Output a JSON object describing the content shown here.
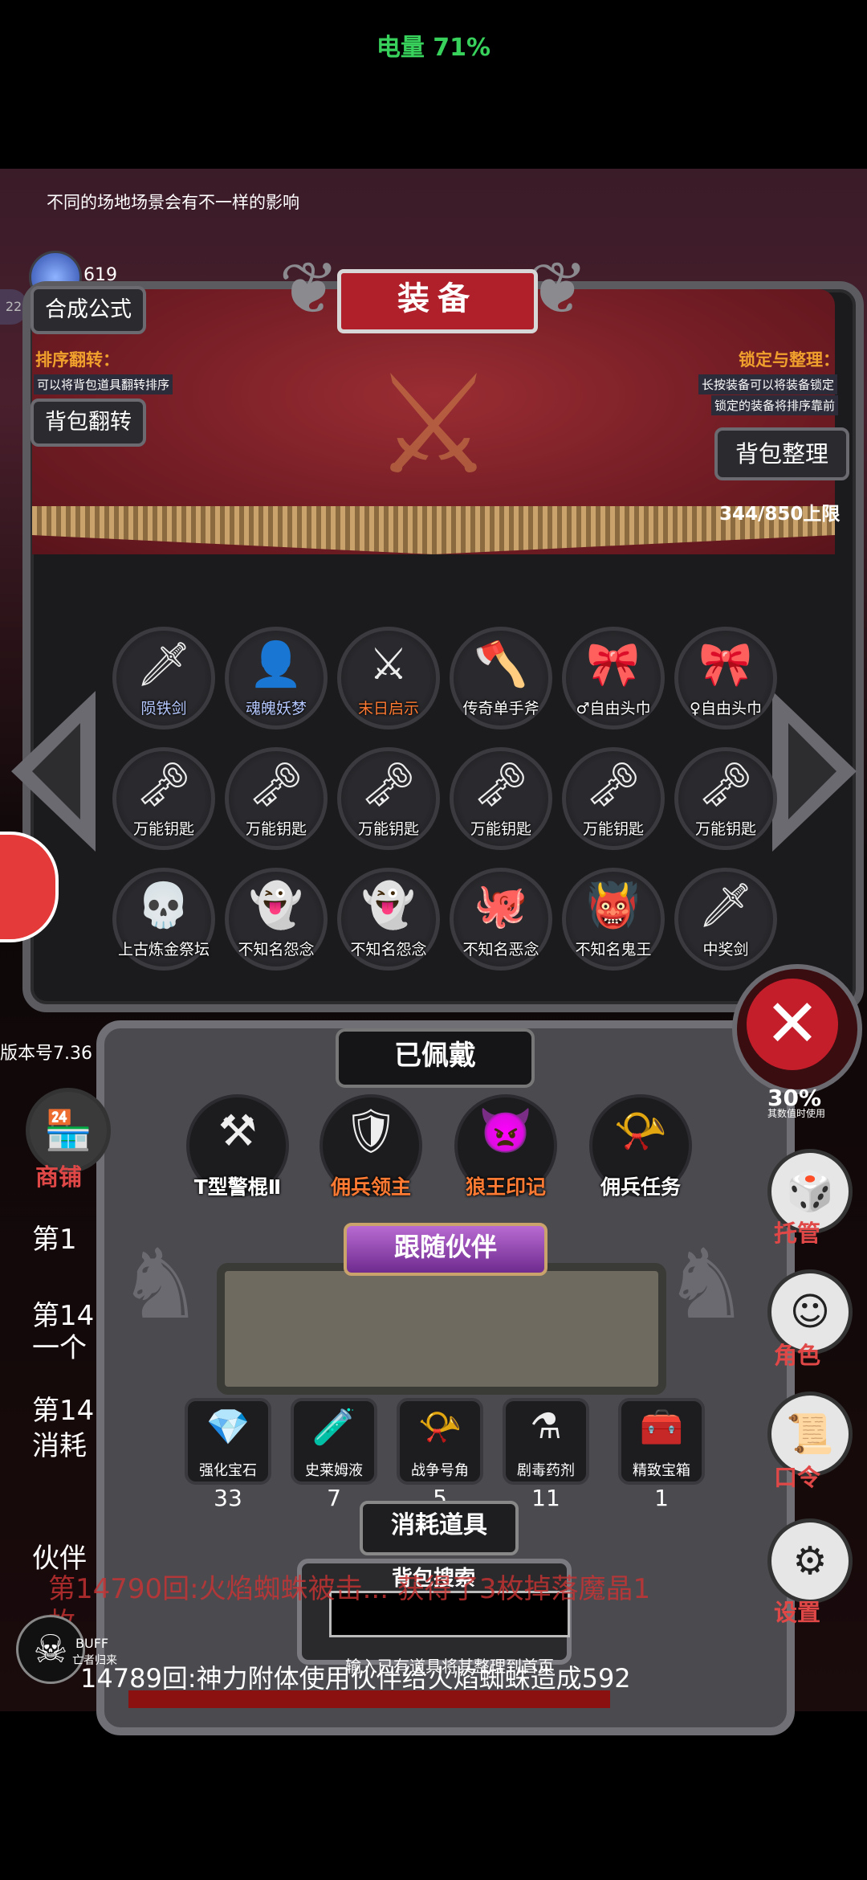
{
  "status": {
    "battery": "电量 71%"
  },
  "scene": {
    "hint": "不同的场地场景会有不一样的影响"
  },
  "currency": {
    "crystal_count": "619",
    "badge": "22"
  },
  "left_buttons": {
    "synthesis": "合成公式",
    "flip": "背包翻转"
  },
  "sort_info": {
    "title": "排序翻转：",
    "desc": "可以将背包道具翻转排序"
  },
  "lock_info": {
    "title": "锁定与整理：",
    "desc1": "长按装备可以将装备锁定",
    "desc2": "锁定的装备将排序靠前"
  },
  "panel": {
    "title": "装备",
    "organize": "背包整理",
    "capacity": "344/850上限"
  },
  "inventory": [
    {
      "label": "陨铁剑",
      "icon": "🗡",
      "color": "blue"
    },
    {
      "label": "魂魄妖梦",
      "icon": "👤",
      "color": "blue"
    },
    {
      "label": "末日启示",
      "icon": "⚔",
      "color": "orange"
    },
    {
      "label": "传奇单手斧",
      "icon": "🪓",
      "color": "white"
    },
    {
      "label": "♂自由头巾",
      "icon": "🎀",
      "color": "white"
    },
    {
      "label": "♀自由头巾",
      "icon": "🎀",
      "color": "white"
    },
    {
      "label": "万能钥匙",
      "icon": "🗝",
      "color": "white"
    },
    {
      "label": "万能钥匙",
      "icon": "🗝",
      "color": "white"
    },
    {
      "label": "万能钥匙",
      "icon": "🗝",
      "color": "white"
    },
    {
      "label": "万能钥匙",
      "icon": "🗝",
      "color": "white"
    },
    {
      "label": "万能钥匙",
      "icon": "🗝",
      "color": "white"
    },
    {
      "label": "万能钥匙",
      "icon": "🗝",
      "color": "white"
    },
    {
      "label": "上古炼金祭坛",
      "icon": "💀",
      "color": "white"
    },
    {
      "label": "不知名怨念",
      "icon": "👻",
      "color": "white"
    },
    {
      "label": "不知名怨念",
      "icon": "👻",
      "color": "white"
    },
    {
      "label": "不知名恶念",
      "icon": "🐙",
      "color": "white"
    },
    {
      "label": "不知名鬼王",
      "icon": "👹",
      "color": "white"
    },
    {
      "label": "中奖剑",
      "icon": "🗡",
      "color": "white"
    }
  ],
  "version": "版本号7.36",
  "nav": {
    "shop": "商铺",
    "manage": "托管",
    "role": "角色",
    "code": "口令",
    "settings": "设置"
  },
  "log": {
    "line1": "第1",
    "line2a": "第14",
    "line2b": "一个",
    "line3a": "第14",
    "line3b": "消耗",
    "line4": "伙伴",
    "line5": "第14790回:火焰蜘蛛被击... 获得了3枚掉落魔晶1",
    "line5b": "枚",
    "line6": "14789回:神力附体使用伙伴给火焰蜘蛛造成592"
  },
  "percent": {
    "value": "30%",
    "sub": "其数值时使用"
  },
  "equipped": {
    "title": "已佩戴",
    "items": [
      {
        "label": "T型警棍Ⅱ",
        "icon": "⚒",
        "color": "white"
      },
      {
        "label": "佣兵领主",
        "icon": "🛡",
        "color": "orange"
      },
      {
        "label": "狼王印记",
        "icon": "👿",
        "color": "orange"
      },
      {
        "label": "佣兵任务",
        "icon": "📯",
        "color": "white"
      }
    ]
  },
  "companion": {
    "title": "跟随伙伴"
  },
  "consumables": {
    "title": "消耗道具",
    "items": [
      {
        "label": "强化宝石",
        "icon": "💎",
        "count": "33"
      },
      {
        "label": "史莱姆液",
        "icon": "🧪",
        "count": "7"
      },
      {
        "label": "战争号角",
        "icon": "📯",
        "count": "5"
      },
      {
        "label": "剧毒药剂",
        "icon": "⚗",
        "count": "11"
      },
      {
        "label": "精致宝箱",
        "icon": "🧰",
        "count": "1"
      }
    ]
  },
  "search": {
    "title": "背包搜索",
    "value": "",
    "hint": "输入已有道具将其整理到首页"
  },
  "buff": {
    "label": "BUFF",
    "desc": "亡者归来"
  },
  "colors": {
    "accent_red": "#b0202b",
    "label_orange": "#ff7a32",
    "label_blue": "#b5c8ff"
  }
}
